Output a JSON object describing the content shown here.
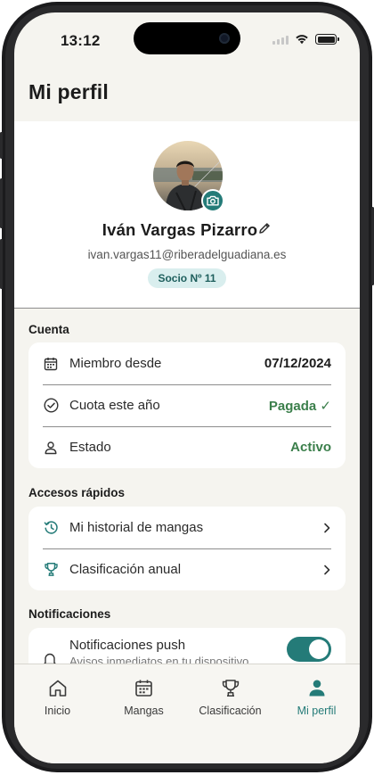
{
  "status_bar": {
    "time": "13:12"
  },
  "header": {
    "title": "Mi perfil"
  },
  "profile": {
    "name": "Iván Vargas Pizarro",
    "email": "ivan.vargas11@riberadelguadiana.es",
    "badge": "Socio Nº 11"
  },
  "account": {
    "section_title": "Cuenta",
    "rows": [
      {
        "icon": "calendar-icon",
        "label": "Miembro desde",
        "value": "07/12/2024"
      },
      {
        "icon": "check-circle-icon",
        "label": "Cuota este año",
        "value": "Pagada ✓"
      },
      {
        "icon": "person-icon",
        "label": "Estado",
        "value": "Activo"
      }
    ]
  },
  "quick_access": {
    "section_title": "Accesos rápidos",
    "items": [
      {
        "icon": "history-icon",
        "label": "Mi historial de mangas"
      },
      {
        "icon": "trophy-icon",
        "label": "Clasificación anual"
      }
    ]
  },
  "notifications": {
    "section_title": "Notificaciones",
    "push_title": "Notificaciones push",
    "push_subtitle": "Avisos inmediatos en tu dispositivo",
    "push_enabled": true
  },
  "tabs": [
    {
      "icon": "home-icon",
      "label": "Inicio",
      "active": false
    },
    {
      "icon": "calendar-icon",
      "label": "Mangas",
      "active": false
    },
    {
      "icon": "trophy-icon",
      "label": "Clasificación",
      "active": false
    },
    {
      "icon": "person-icon",
      "label": "Mi perfil",
      "active": true
    }
  ],
  "colors": {
    "accent": "#247b78",
    "positive": "#3b7f4b",
    "background": "#f5f4ef",
    "badge_bg": "#d9eeee"
  }
}
